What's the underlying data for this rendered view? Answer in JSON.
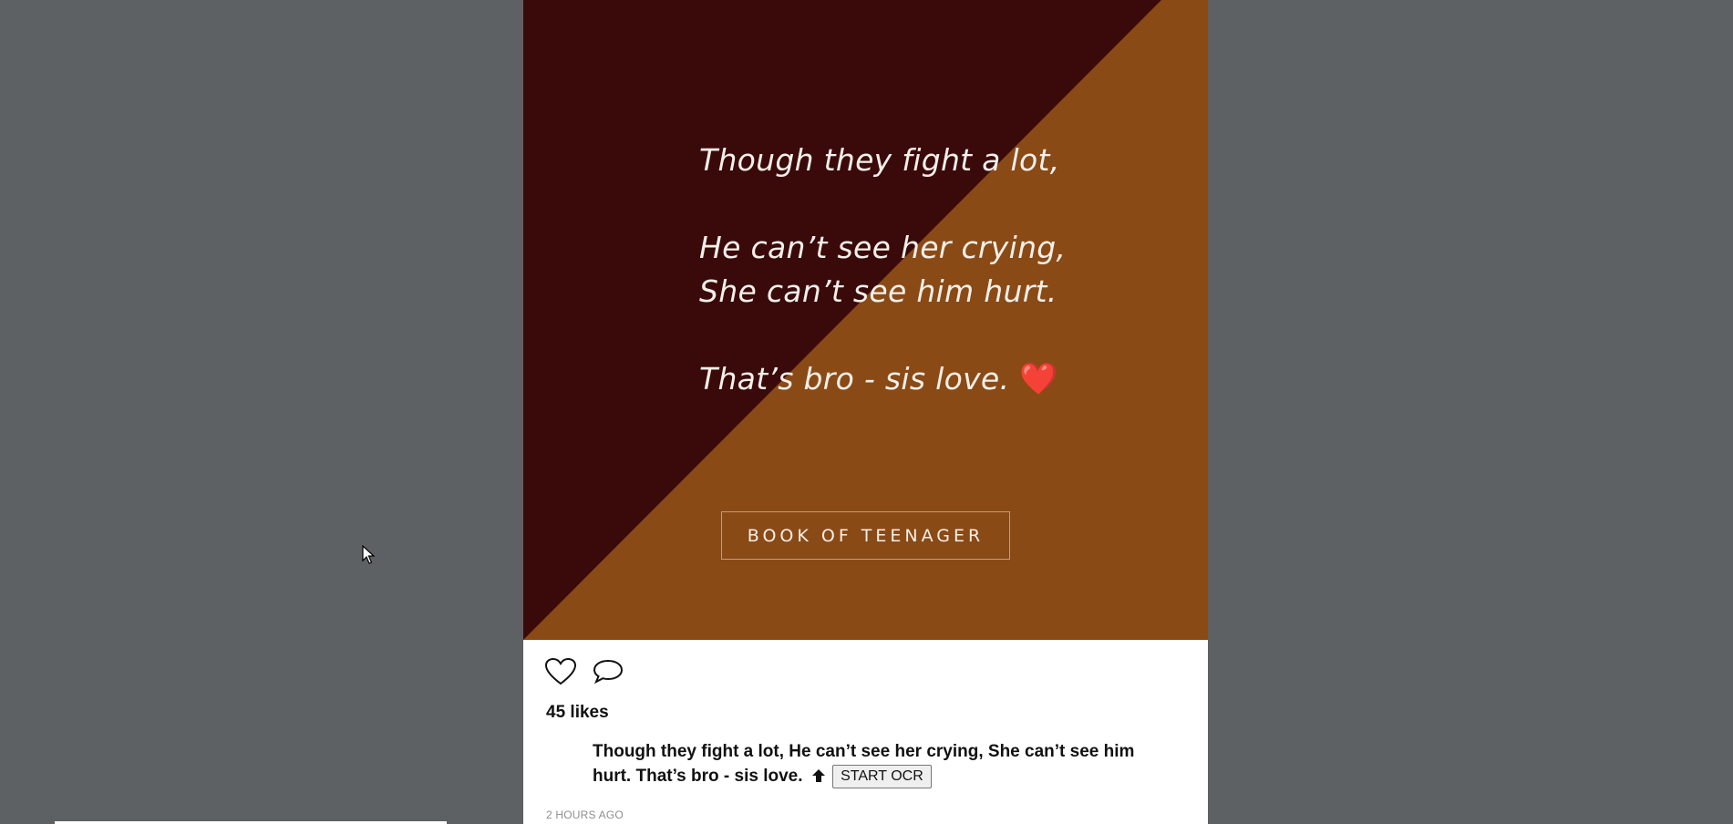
{
  "post": {
    "image": {
      "colors": {
        "dark": "#3a0a0b",
        "light": "#8a4a16"
      },
      "quote_lines": [
        "Though they fight a lot,",
        "He can’t see her crying,",
        "She can’t see him hurt.",
        "That’s bro - sis love."
      ],
      "heart": "❤️",
      "brand": "BOOK OF TEENAGER"
    },
    "actions": {
      "like_icon": "heart-outline-icon",
      "comment_icon": "speech-bubble-icon"
    },
    "likes": "45 likes",
    "caption_line1": "Though they fight a lot, He can’t see her crying, She can’t see him",
    "caption_line2": "hurt. That’s bro - sis love.",
    "caption_arrow_icon": "arrow-up-icon",
    "ocr_button": "START OCR",
    "timestamp": "2 HOURS AGO"
  }
}
